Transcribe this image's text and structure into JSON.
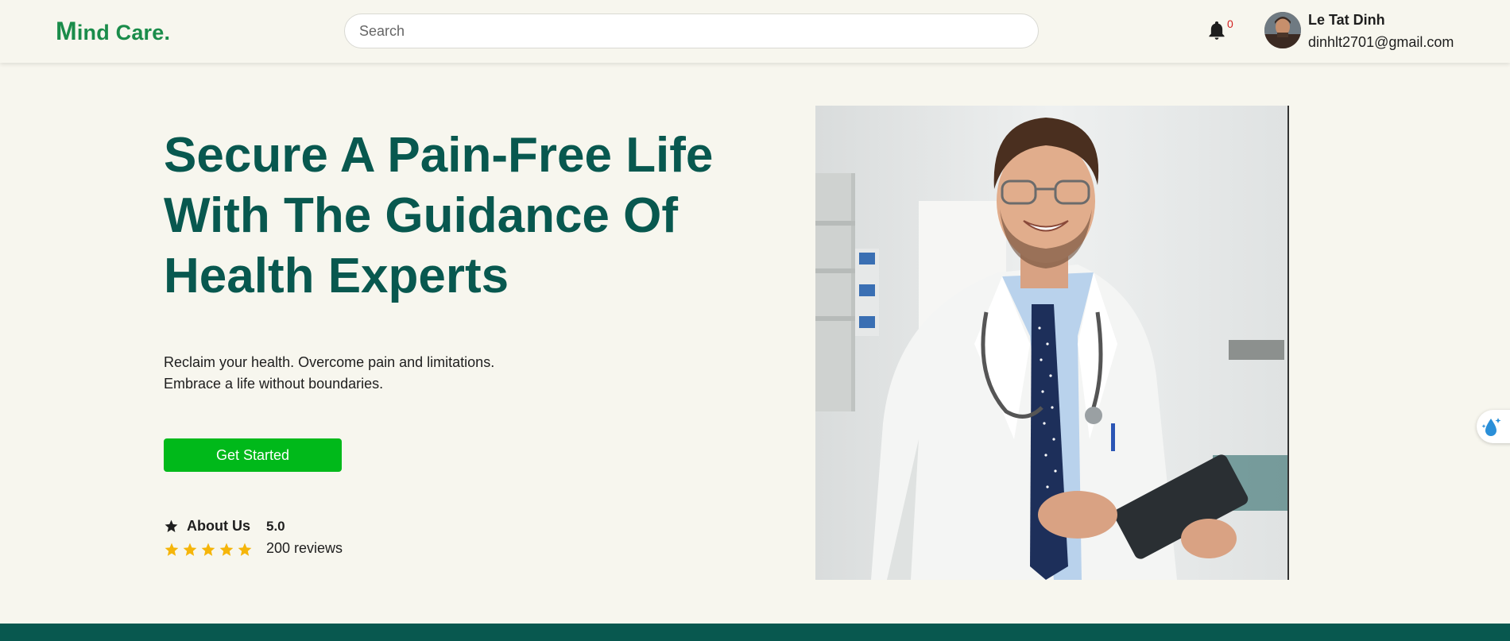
{
  "header": {
    "logo_first": "M",
    "logo_rest": "ind Care.",
    "search_placeholder": "Search",
    "notification_count": "0",
    "user": {
      "name": "Le Tat Dinh",
      "email": "dinhlt2701@gmail.com"
    }
  },
  "hero": {
    "title": "Secure A Pain-Free Life With The Guidance Of Health Experts",
    "desc_line1": "Reclaim your health. Overcome pain and limitations.",
    "desc_line2": "Embrace a life without boundaries.",
    "cta_label": "Get Started",
    "about_label": "About Us",
    "rating": "5.0",
    "stars": 5,
    "reviews": "200 reviews"
  },
  "colors": {
    "brand_green": "#1a8c4a",
    "heading_teal": "#08584f",
    "cta_green": "#00b91a",
    "star_gold": "#f5b50a",
    "background": "#f7f6ee"
  },
  "icons": [
    "bell-icon",
    "star-icon",
    "water-drop-icon"
  ]
}
